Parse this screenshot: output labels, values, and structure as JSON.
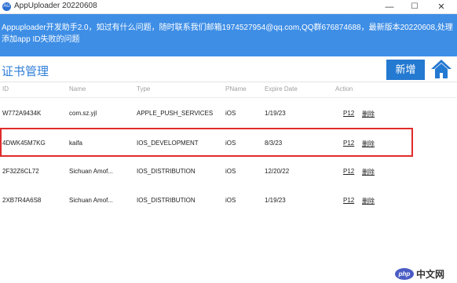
{
  "window": {
    "icon_text": "AU",
    "title": "AppUploader 20220608",
    "controls": {
      "minimize": "—",
      "maximize": "☐",
      "close": "✕"
    }
  },
  "banner": {
    "text": "Appuploader开发助手2.0，如过有什么问题，随时联系我们邮箱1974527954@qq.com,QQ群676874688，最新版本20220608,处理添加app ID失败的问题"
  },
  "toolbar": {
    "title": "证书管理",
    "add_label": "新增",
    "home_icon": "home-icon"
  },
  "table": {
    "columns": [
      "ID",
      "Name",
      "Type",
      "PName",
      "Expire Date",
      "Action"
    ],
    "rows": [
      {
        "id": "W772A9434K",
        "name": "com.sz.yjl",
        "type": "APPLE_PUSH_SERVICES",
        "pname": "iOS",
        "expire": "1/19/23",
        "p12": "P12",
        "del": "删除"
      },
      {
        "id": "4DWK45M7KG",
        "name": "kaifa",
        "type": "IOS_DEVELOPMENT",
        "pname": "iOS",
        "expire": "8/3/23",
        "p12": "P12",
        "del": "删除"
      },
      {
        "id": "2F32Z6CL72",
        "name": "Sichuan Amof...",
        "type": "IOS_DISTRIBUTION",
        "pname": "iOS",
        "expire": "12/20/22",
        "p12": "P12",
        "del": "删除"
      },
      {
        "id": "2XB7R4A6S8",
        "name": "Sichuan Amof...",
        "type": "IOS_DISTRIBUTION",
        "pname": "iOS",
        "expire": "1/19/23",
        "p12": "P12",
        "del": "删除"
      }
    ]
  },
  "watermark": {
    "badge": "php",
    "text": "中文网"
  },
  "colors": {
    "banner": "#3e8ee6",
    "accent": "#2479d1",
    "highlight": "#e02b2b"
  }
}
